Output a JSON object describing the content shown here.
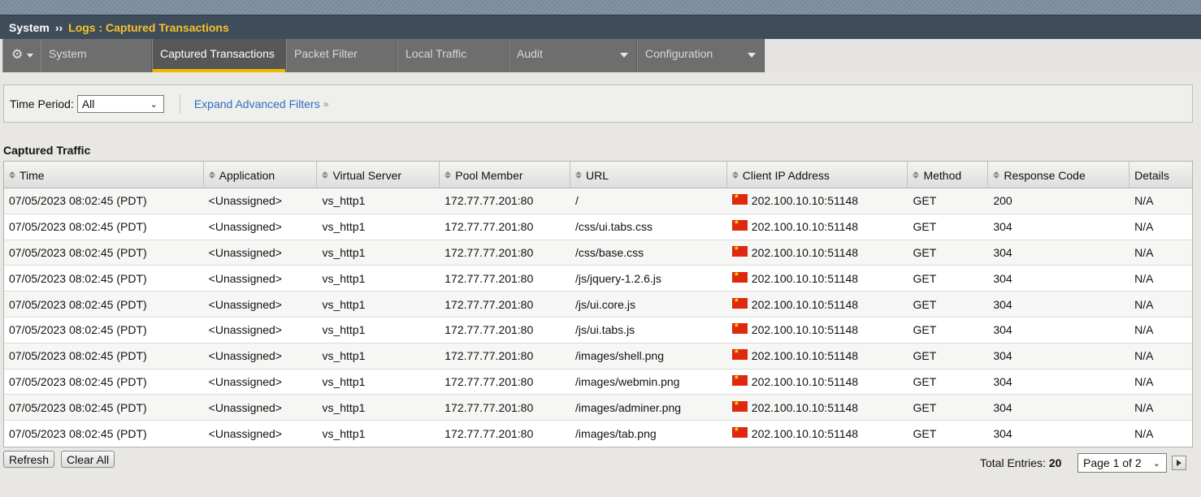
{
  "breadcrumb": {
    "root": "System",
    "separator": "››",
    "current": "Logs : Captured Transactions"
  },
  "nav": {
    "tabs": [
      {
        "label": "System",
        "name": "tab-system",
        "has_menu": false
      },
      {
        "label": "Captured Transactions",
        "name": "tab-captured-transactions",
        "has_menu": false,
        "active": true
      },
      {
        "label": "Packet Filter",
        "name": "tab-packet-filter",
        "has_menu": false
      },
      {
        "label": "Local Traffic",
        "name": "tab-local-traffic",
        "has_menu": false
      },
      {
        "label": "Audit",
        "name": "tab-audit",
        "has_menu": true
      },
      {
        "label": "Configuration",
        "name": "tab-configuration",
        "has_menu": true
      }
    ],
    "gear_icon": "gear-icon"
  },
  "filters": {
    "time_period_label": "Time Period:",
    "time_period_value": "All",
    "expand_link": "Expand Advanced Filters",
    "expand_icon": "double-chevron-down-icon"
  },
  "section_title": "Captured Traffic",
  "table": {
    "columns": [
      "Time",
      "Application",
      "Virtual Server",
      "Pool Member",
      "URL",
      "Client IP Address",
      "Method",
      "Response Code",
      "Details"
    ],
    "rows": [
      {
        "time": "07/05/2023 08:02:45 (PDT)",
        "application": "<Unassigned>",
        "virtual_server": "vs_http1",
        "pool_member": "172.77.77.201:80",
        "url": "/",
        "client_ip": "202.100.10.10:51148",
        "method": "GET",
        "response_code": "200",
        "details": "N/A"
      },
      {
        "time": "07/05/2023 08:02:45 (PDT)",
        "application": "<Unassigned>",
        "virtual_server": "vs_http1",
        "pool_member": "172.77.77.201:80",
        "url": "/css/ui.tabs.css",
        "client_ip": "202.100.10.10:51148",
        "method": "GET",
        "response_code": "304",
        "details": "N/A"
      },
      {
        "time": "07/05/2023 08:02:45 (PDT)",
        "application": "<Unassigned>",
        "virtual_server": "vs_http1",
        "pool_member": "172.77.77.201:80",
        "url": "/css/base.css",
        "client_ip": "202.100.10.10:51148",
        "method": "GET",
        "response_code": "304",
        "details": "N/A"
      },
      {
        "time": "07/05/2023 08:02:45 (PDT)",
        "application": "<Unassigned>",
        "virtual_server": "vs_http1",
        "pool_member": "172.77.77.201:80",
        "url": "/js/jquery-1.2.6.js",
        "client_ip": "202.100.10.10:51148",
        "method": "GET",
        "response_code": "304",
        "details": "N/A"
      },
      {
        "time": "07/05/2023 08:02:45 (PDT)",
        "application": "<Unassigned>",
        "virtual_server": "vs_http1",
        "pool_member": "172.77.77.201:80",
        "url": "/js/ui.core.js",
        "client_ip": "202.100.10.10:51148",
        "method": "GET",
        "response_code": "304",
        "details": "N/A"
      },
      {
        "time": "07/05/2023 08:02:45 (PDT)",
        "application": "<Unassigned>",
        "virtual_server": "vs_http1",
        "pool_member": "172.77.77.201:80",
        "url": "/js/ui.tabs.js",
        "client_ip": "202.100.10.10:51148",
        "method": "GET",
        "response_code": "304",
        "details": "N/A"
      },
      {
        "time": "07/05/2023 08:02:45 (PDT)",
        "application": "<Unassigned>",
        "virtual_server": "vs_http1",
        "pool_member": "172.77.77.201:80",
        "url": "/images/shell.png",
        "client_ip": "202.100.10.10:51148",
        "method": "GET",
        "response_code": "304",
        "details": "N/A"
      },
      {
        "time": "07/05/2023 08:02:45 (PDT)",
        "application": "<Unassigned>",
        "virtual_server": "vs_http1",
        "pool_member": "172.77.77.201:80",
        "url": "/images/webmin.png",
        "client_ip": "202.100.10.10:51148",
        "method": "GET",
        "response_code": "304",
        "details": "N/A"
      },
      {
        "time": "07/05/2023 08:02:45 (PDT)",
        "application": "<Unassigned>",
        "virtual_server": "vs_http1",
        "pool_member": "172.77.77.201:80",
        "url": "/images/adminer.png",
        "client_ip": "202.100.10.10:51148",
        "method": "GET",
        "response_code": "304",
        "details": "N/A"
      },
      {
        "time": "07/05/2023 08:02:45 (PDT)",
        "application": "<Unassigned>",
        "virtual_server": "vs_http1",
        "pool_member": "172.77.77.201:80",
        "url": "/images/tab.png",
        "client_ip": "202.100.10.10:51148",
        "method": "GET",
        "response_code": "304",
        "details": "N/A"
      }
    ],
    "flag_icon": "china-flag-icon"
  },
  "buttons": {
    "refresh": "Refresh",
    "clear_all": "Clear All"
  },
  "pagination": {
    "total_label": "Total Entries:",
    "total_value": "20",
    "page_value": "Page 1 of 2"
  },
  "colors": {
    "accent": "#f5b800",
    "crumb_current": "#f5c32c",
    "link": "#2f6fc0",
    "nav_bg": "#6e6e6e",
    "nav_active": "#575757"
  }
}
